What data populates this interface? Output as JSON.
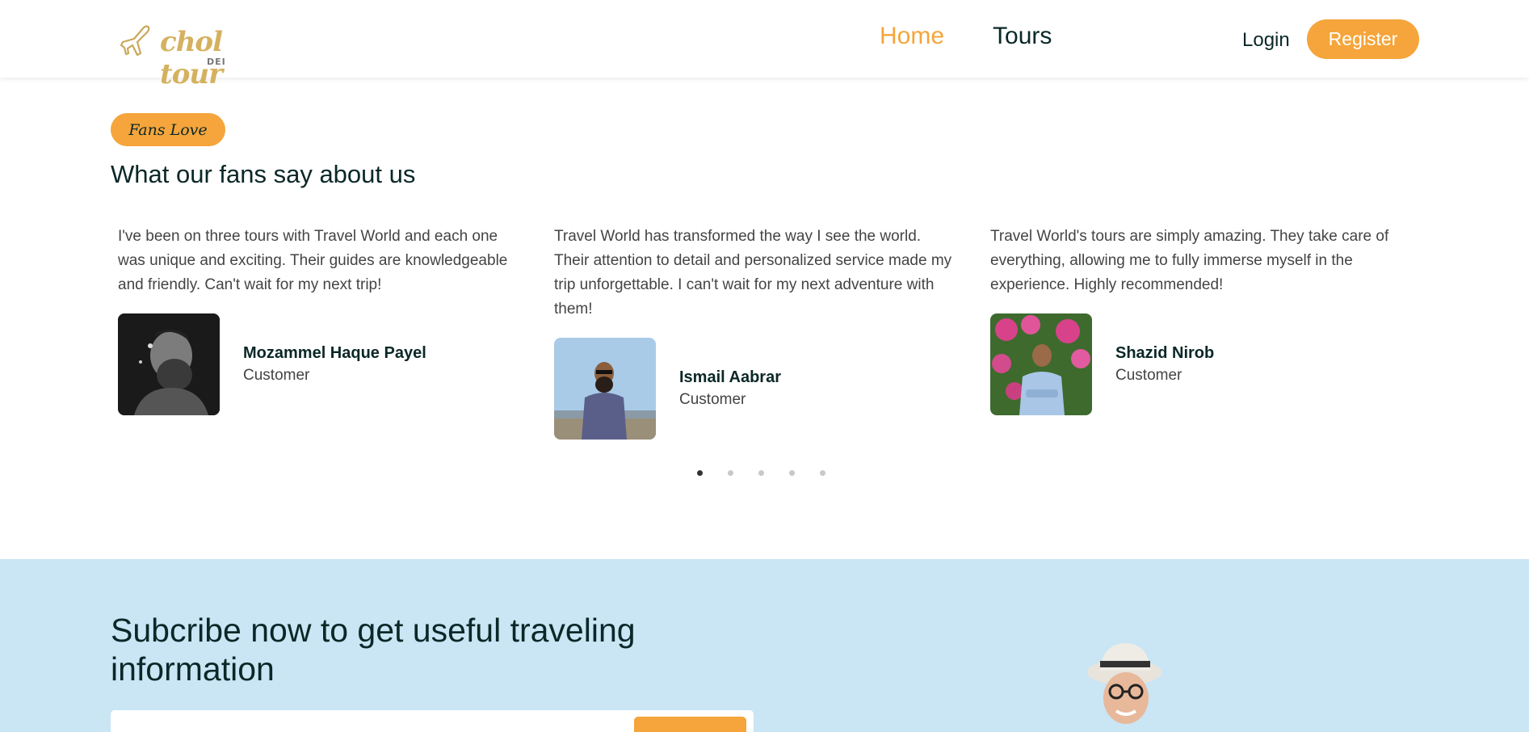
{
  "header": {
    "logo_text": "chol tour",
    "logo_sub": "DEI",
    "nav": [
      {
        "label": "Home",
        "active": true
      },
      {
        "label": "Tours",
        "active": false
      }
    ],
    "login_label": "Login",
    "register_label": "Register"
  },
  "testimonials": {
    "badge": "Fans Love",
    "title": "What our fans say about us",
    "items": [
      {
        "text": "I've been on three tours with Travel World and each one was unique and exciting. Their guides are knowledgeable and friendly. Can't wait for my next trip!",
        "name": "Mozammel Haque Payel",
        "role": "Customer"
      },
      {
        "text": "Travel World has transformed the way I see the world. Their attention to detail and personalized service made my trip unforgettable. I can't wait for my next adventure with them!",
        "name": "Ismail Aabrar",
        "role": "Customer"
      },
      {
        "text": "Travel World's tours are simply amazing. They take care of everything, allowing me to fully immerse myself in the experience. Highly recommended!",
        "name": "Shazid Nirob",
        "role": "Customer"
      }
    ],
    "dots_count": 5,
    "active_dot": 0
  },
  "newsletter": {
    "title": "Subcribe now to get useful traveling information",
    "input_placeholder": "",
    "button_label": ""
  },
  "colors": {
    "accent": "#f5a53b",
    "heading": "#0b2727",
    "newsletter_bg": "#cae5f4"
  }
}
